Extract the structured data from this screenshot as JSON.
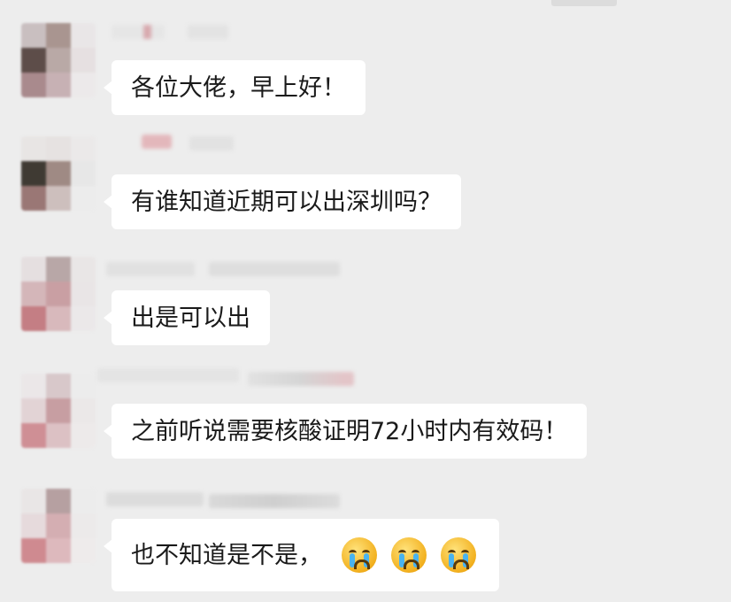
{
  "chat": {
    "messages": [
      {
        "text": "各位大佬，早上好！"
      },
      {
        "text": "有谁知道近期可以出深圳吗？"
      },
      {
        "text": "出是可以出"
      },
      {
        "text": "之前听说需要核酸证明72小时内有效码！"
      },
      {
        "text": "也不知道是不是，",
        "emojis": [
          "crying-face-icon",
          "crying-face-icon",
          "crying-face-icon"
        ]
      }
    ]
  },
  "colors": {
    "background": "#ededed",
    "bubble": "#ffffff",
    "text": "#1a1a1a"
  }
}
